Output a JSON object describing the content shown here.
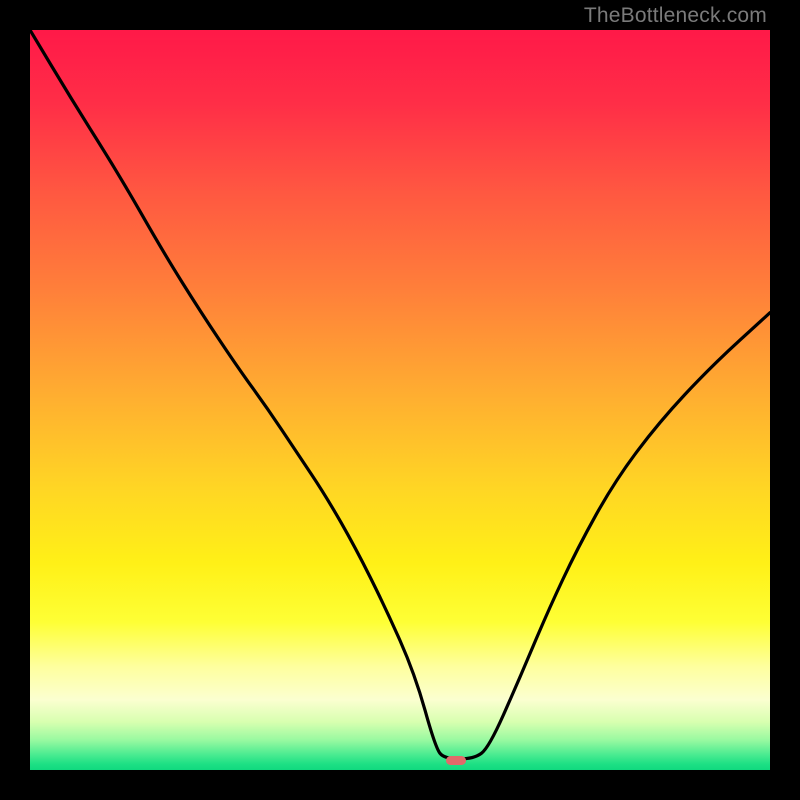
{
  "watermark": "TheBottleneck.com",
  "marker": {
    "color": "#e06a6a",
    "x_frac": 0.575,
    "y_frac": 0.986
  },
  "gradient_stops": [
    {
      "offset": 0.0,
      "color": "#ff1948"
    },
    {
      "offset": 0.1,
      "color": "#ff2e47"
    },
    {
      "offset": 0.22,
      "color": "#ff5841"
    },
    {
      "offset": 0.35,
      "color": "#ff7f3a"
    },
    {
      "offset": 0.5,
      "color": "#ffb030"
    },
    {
      "offset": 0.62,
      "color": "#ffd624"
    },
    {
      "offset": 0.72,
      "color": "#fff017"
    },
    {
      "offset": 0.8,
      "color": "#feff35"
    },
    {
      "offset": 0.86,
      "color": "#feff9e"
    },
    {
      "offset": 0.905,
      "color": "#fbffd0"
    },
    {
      "offset": 0.935,
      "color": "#d8ffb0"
    },
    {
      "offset": 0.96,
      "color": "#97f9a0"
    },
    {
      "offset": 0.978,
      "color": "#4fec92"
    },
    {
      "offset": 0.992,
      "color": "#1de084"
    },
    {
      "offset": 1.0,
      "color": "#10d97f"
    }
  ],
  "chart_data": {
    "type": "line",
    "title": "",
    "xlabel": "",
    "ylabel": "",
    "xlim": [
      0,
      1
    ],
    "ylim": [
      0,
      1
    ],
    "series": [
      {
        "name": "bottleneck-curve",
        "x": [
          0.0,
          0.06,
          0.12,
          0.18,
          0.23,
          0.28,
          0.32,
          0.36,
          0.4,
          0.44,
          0.48,
          0.52,
          0.548,
          0.56,
          0.6,
          0.62,
          0.66,
          0.7,
          0.74,
          0.79,
          0.85,
          0.92,
          1.0
        ],
        "y": [
          1.0,
          0.9,
          0.805,
          0.7,
          0.62,
          0.545,
          0.49,
          0.43,
          0.37,
          0.3,
          0.22,
          0.13,
          0.03,
          0.015,
          0.015,
          0.03,
          0.12,
          0.215,
          0.3,
          0.39,
          0.47,
          0.545,
          0.618
        ]
      }
    ],
    "annotations": [
      {
        "text": "TheBottleneck.com",
        "pos": "top-right"
      }
    ]
  }
}
